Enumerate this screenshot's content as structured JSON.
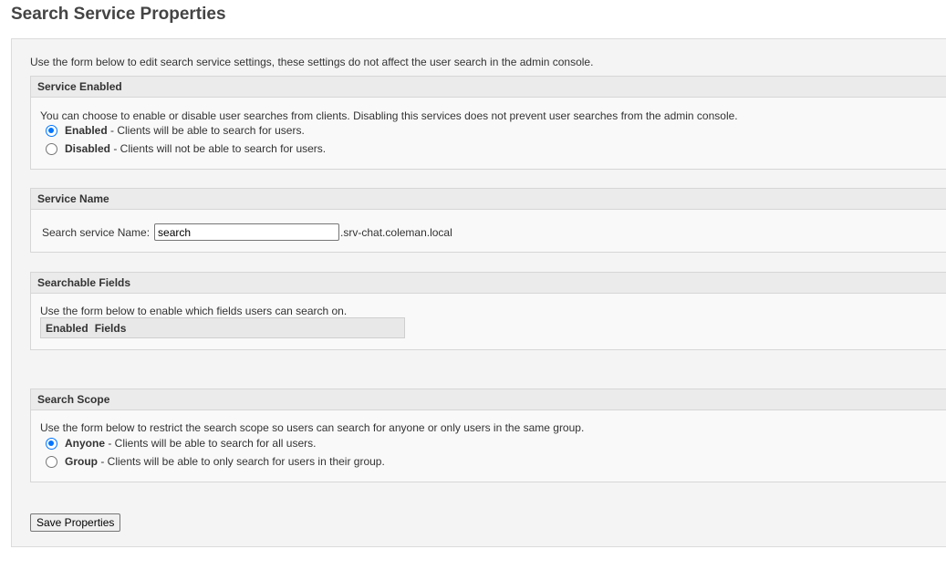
{
  "page": {
    "title": "Search Service Properties",
    "intro": "Use the form below to edit search service settings, these settings do not affect the user search in the admin console."
  },
  "service_enabled": {
    "header": "Service Enabled",
    "description": "You can choose to enable or disable user searches from clients. Disabling this services does not prevent user searches from the admin console.",
    "options": [
      {
        "label": "Enabled",
        "desc": " - Clients will be able to search for users.",
        "checked": true
      },
      {
        "label": "Disabled",
        "desc": " - Clients will not be able to search for users.",
        "checked": false
      }
    ]
  },
  "service_name": {
    "header": "Service Name",
    "label": "Search service Name:",
    "value": "search",
    "suffix": ".srv-chat.coleman.local"
  },
  "searchable_fields": {
    "header": "Searchable Fields",
    "description": "Use the form below to enable which fields users can search on.",
    "columns": [
      "Enabled",
      "Fields"
    ]
  },
  "search_scope": {
    "header": "Search Scope",
    "description": "Use the form below to restrict the search scope so users can search for anyone or only users in the same group.",
    "options": [
      {
        "label": "Anyone",
        "desc": " - Clients will be able to search for all users.",
        "checked": true
      },
      {
        "label": "Group",
        "desc": " - Clients will be able to only search for users in their group.",
        "checked": false
      }
    ]
  },
  "actions": {
    "save_label": "Save Properties"
  },
  "colors": {
    "radio_accent": "#0075ff",
    "section_header_bg": "#ebebeb",
    "panel_bg": "#f4f4f4"
  }
}
